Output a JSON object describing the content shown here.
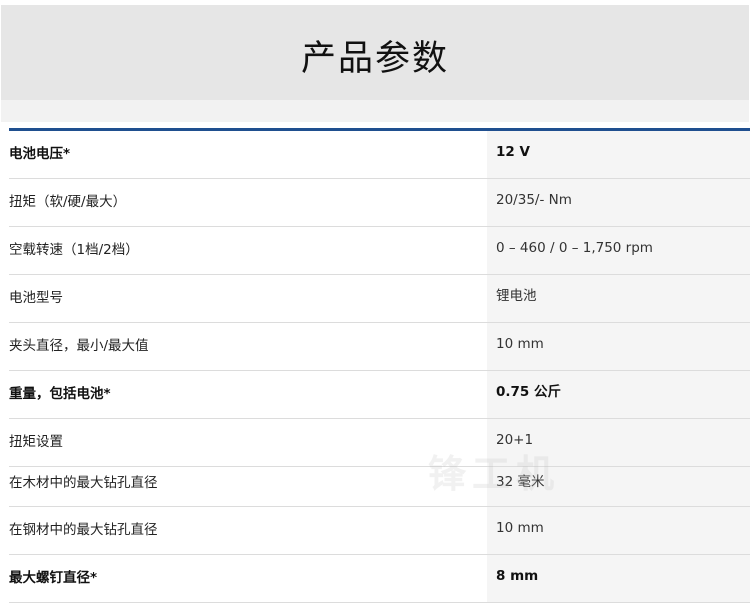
{
  "header": {
    "title": "产品参数"
  },
  "specs": [
    {
      "label": "电池电压*",
      "value": "12 V",
      "bold": true
    },
    {
      "label": "扭矩（软/硬/最大）",
      "value": "20/35/- Nm",
      "bold": false
    },
    {
      "label": "空载转速（1档/2档）",
      "value": "0 – 460 / 0 – 1,750 rpm",
      "bold": false
    },
    {
      "label": "电池型号",
      "value": "锂电池",
      "bold": false
    },
    {
      "label": "夹头直径，最小/最大值",
      "value": "10 mm",
      "bold": false
    },
    {
      "label": "重量，包括电池*",
      "value": "0.75 公斤",
      "bold": true
    },
    {
      "label": "扭矩设置",
      "value": "20+1",
      "bold": false
    },
    {
      "label": "在木材中的最大钻孔直径",
      "value": "32 毫米",
      "bold": false
    },
    {
      "label": "在钢材中的最大钻孔直径",
      "value": "10 mm",
      "bold": false
    },
    {
      "label": "最大螺钉直径*",
      "value": "8 mm",
      "bold": true
    }
  ],
  "watermark": {
    "text": "锋工机"
  },
  "colors": {
    "accent_rule": "#1f4f8f",
    "header_bg": "#e6e6e6",
    "value_bg": "#f5f5f5"
  }
}
